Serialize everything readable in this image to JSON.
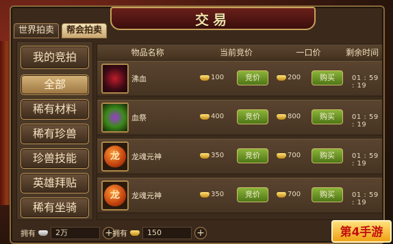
{
  "window": {
    "title": "交易"
  },
  "tabs": [
    {
      "label": "世界拍卖",
      "active": false
    },
    {
      "label": "帮会拍卖",
      "active": true
    }
  ],
  "menu": {
    "mine": "我的竞拍",
    "items": [
      {
        "label": "全部",
        "selected": true
      },
      {
        "label": "稀有材料",
        "selected": false
      },
      {
        "label": "稀有珍兽",
        "selected": false
      },
      {
        "label": "珍兽技能",
        "selected": false
      },
      {
        "label": "英雄拜贴",
        "selected": false
      },
      {
        "label": "稀有坐骑",
        "selected": false
      }
    ]
  },
  "table": {
    "headers": [
      "物品名称",
      "当前竞价",
      "一口价",
      "剩余时间"
    ],
    "rows": [
      {
        "name": "沸血",
        "icon": "red-weapon-icon",
        "bid": "100",
        "bid_label": "竞价",
        "buyout": "200",
        "buy_label": "购买",
        "time": "01 : 59 : 19"
      },
      {
        "name": "血祭",
        "icon": "green-weapon-icon",
        "bid": "400",
        "bid_label": "竞价",
        "buyout": "800",
        "buy_label": "购买",
        "time": "01 : 59 : 19"
      },
      {
        "name": "龙魂元神",
        "icon": "dragon-orb-icon",
        "icon_char": "龙",
        "bid": "350",
        "bid_label": "竞价",
        "buyout": "700",
        "buy_label": "购买",
        "time": "01 : 59 : 19"
      },
      {
        "name": "龙魂元神",
        "icon": "dragon-orb-icon",
        "icon_char": "龙",
        "bid": "350",
        "bid_label": "竞价",
        "buyout": "700",
        "buy_label": "购买",
        "time": "01 : 59 : 19"
      }
    ]
  },
  "footer": {
    "own_label_1": "拥有",
    "silver_amount": "2万",
    "own_label_2": "拥有",
    "gold_amount": "150"
  },
  "badge": {
    "text": "第4手游"
  },
  "colors": {
    "bid_button": "#6b9a2a",
    "title_plate": "#5a1a16",
    "accent": "#c9a25a"
  }
}
